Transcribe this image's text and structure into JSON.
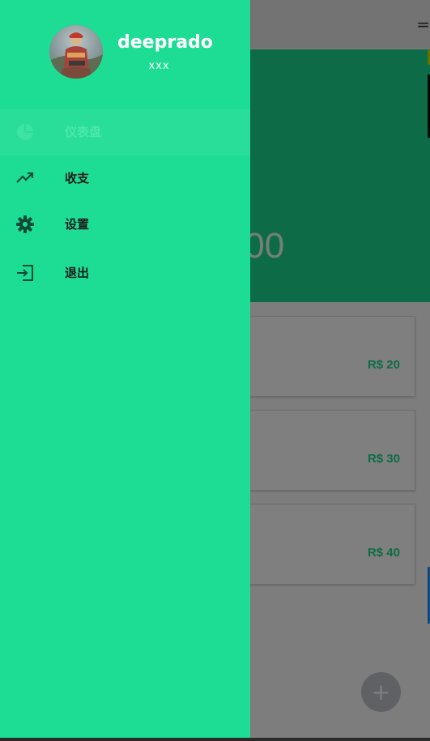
{
  "app": {
    "toolbar_edge_text": "=",
    "balance_text": ".00",
    "cards": [
      {
        "amount": "R$ 20"
      },
      {
        "amount": "R$ 30"
      },
      {
        "amount": "R$ 40"
      }
    ],
    "fab_symbol": "+"
  },
  "drawer": {
    "profile": {
      "name": "deeprado",
      "subtitle": "xxx",
      "avatar_icon": "user-photo"
    },
    "menu": [
      {
        "label": "仪表盘",
        "icon": "pie-chart-icon",
        "active": true
      },
      {
        "label": "收支",
        "icon": "trending-up-icon",
        "active": false
      },
      {
        "label": "设置",
        "icon": "gear-icon",
        "active": false
      },
      {
        "label": "退出",
        "icon": "exit-icon",
        "active": false
      }
    ]
  },
  "colors": {
    "drawer_bg": "#1ddd94",
    "accent": "#1bd98f",
    "active_label": "#4fe7ac",
    "icon_dark": "#0f4a37"
  }
}
